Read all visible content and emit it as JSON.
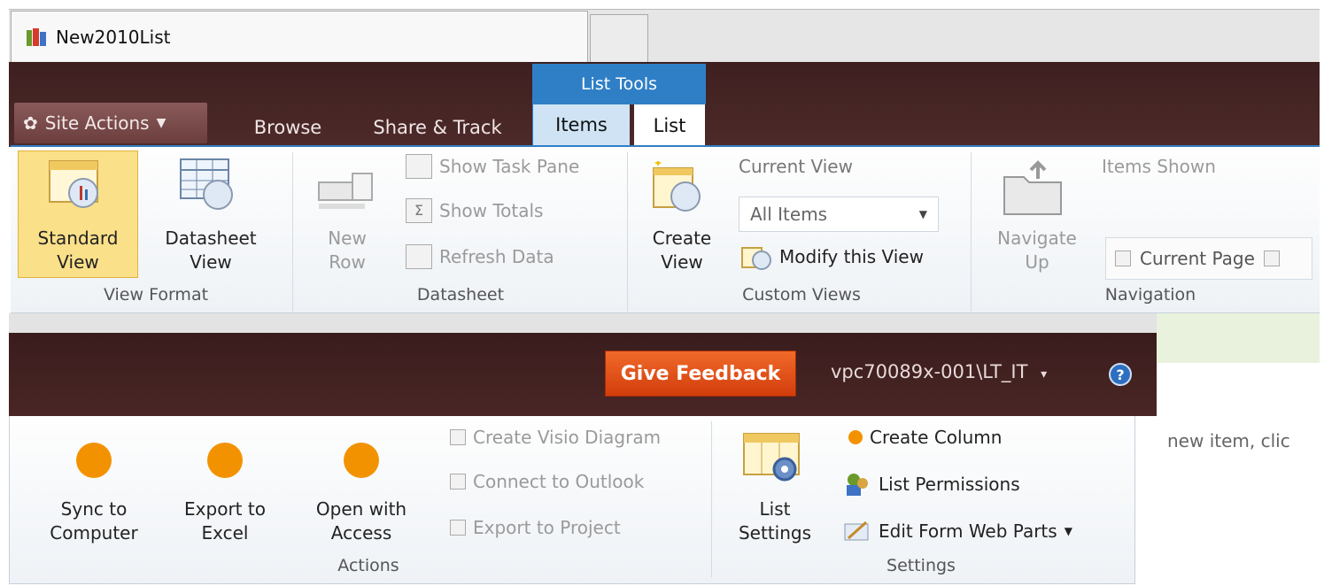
{
  "browser": {
    "tab_title": "New2010List"
  },
  "ribbon_top": {
    "site_actions": "Site Actions",
    "tabs": {
      "browse": "Browse",
      "share_track": "Share & Track",
      "items": "Items",
      "list": "List"
    },
    "contextual_group": "List Tools",
    "groups": {
      "view_format": {
        "label": "View Format",
        "standard_view": {
          "line1": "Standard",
          "line2": "View"
        },
        "datasheet_view": {
          "line1": "Datasheet",
          "line2": "View"
        }
      },
      "datasheet": {
        "label": "Datasheet",
        "new_row": {
          "line1": "New",
          "line2": "Row"
        },
        "show_task_pane": "Show Task Pane",
        "show_totals": "Show Totals",
        "refresh_data": "Refresh Data"
      },
      "custom_views": {
        "label": "Custom Views",
        "create_view": {
          "line1": "Create",
          "line2": "View"
        },
        "current_view_label": "Current View",
        "current_view_value": "All Items",
        "modify_view": "Modify this View"
      },
      "navigation": {
        "label": "Navigation",
        "navigate_up": {
          "line1": "Navigate",
          "line2": "Up"
        },
        "items_shown": "Items Shown",
        "current_page": "Current Page"
      }
    }
  },
  "header": {
    "give_feedback": "Give Feedback",
    "user": "vpc70089x-001\\LT_IT",
    "user_caret": "▾",
    "help": "?"
  },
  "ribbon_bottom": {
    "actions": {
      "label": "Actions",
      "sync": {
        "line1": "Sync to",
        "line2": "Computer"
      },
      "export_excel": {
        "line1": "Export to",
        "line2": "Excel"
      },
      "open_access": {
        "line1": "Open with",
        "line2": "Access"
      },
      "create_visio": "Create Visio Diagram",
      "connect_outlook": "Connect to Outlook",
      "export_project": "Export to Project"
    },
    "settings": {
      "label": "Settings",
      "list_settings": {
        "line1": "List",
        "line2": "Settings"
      },
      "create_column": "Create Column",
      "list_permissions": "List Permissions",
      "edit_form": "Edit Form Web Parts"
    }
  },
  "page_text": "new item, clic",
  "colors": {
    "ribbon_blue": "#2f7fc6",
    "dark_bar": "#3e1f1f",
    "feedback": "#e04f16",
    "action_dot": "#f39200"
  }
}
